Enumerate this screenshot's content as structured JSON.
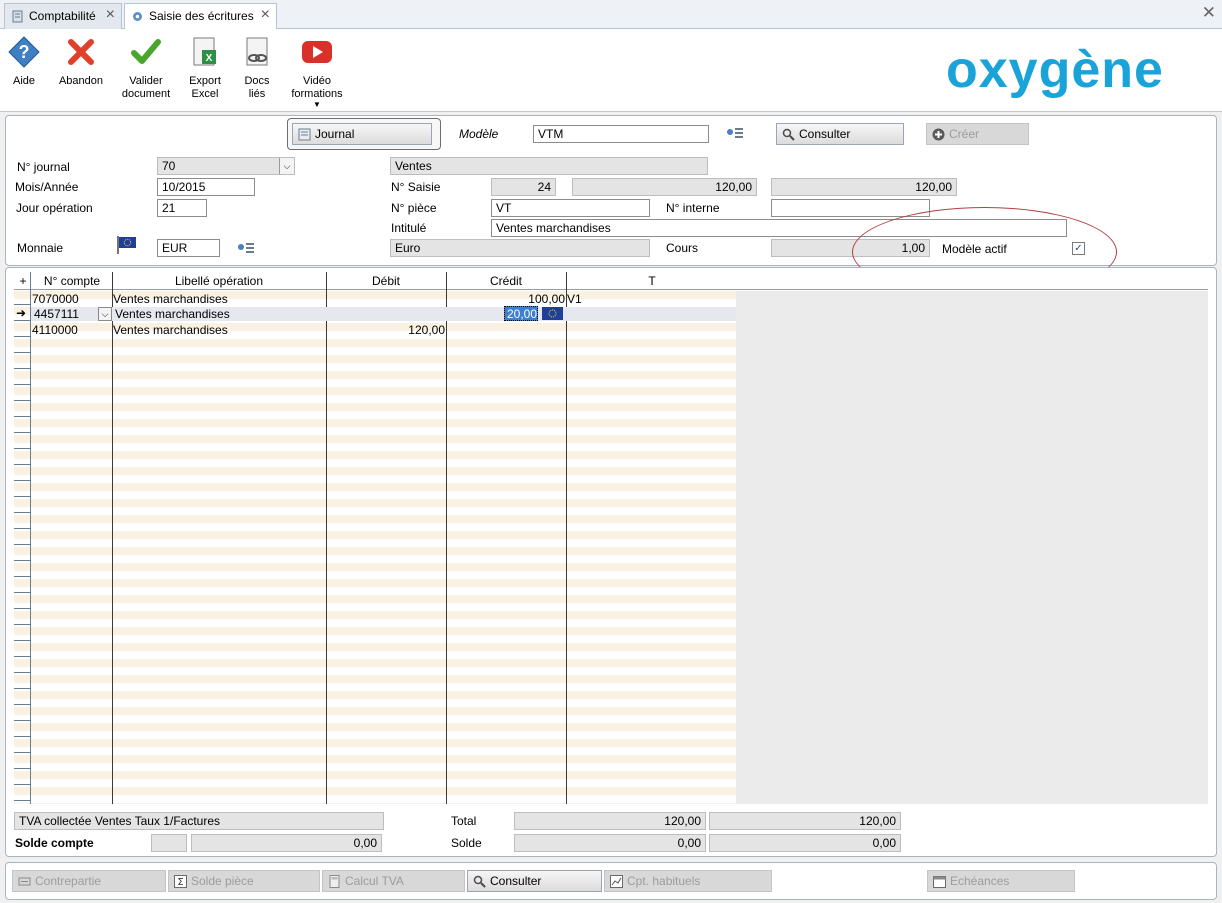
{
  "tabs": [
    {
      "label": "Comptabilité"
    },
    {
      "label": "Saisie des écritures"
    }
  ],
  "toolbar": {
    "aide": "Aide",
    "abandon": "Abandon",
    "valider_1": "Valider",
    "valider_2": "document",
    "export_1": "Export",
    "export_2": "Excel",
    "docs_1": "Docs",
    "docs_2": "liés",
    "video_1": "Vidéo",
    "video_2": "formations",
    "logo": "oxygène"
  },
  "header": {
    "journal_btn": "Journal",
    "modele_label": "Modèle",
    "modele_value": "VTM",
    "consulter_btn": "Consulter",
    "creer_btn": "Créer",
    "n_journal_label": "N° journal",
    "n_journal_value": "70",
    "journal_name": "Ventes",
    "mois_annee_label": "Mois/Année",
    "mois_annee_value": "10/2015",
    "n_saisie_label": "N° Saisie",
    "n_saisie_value": "24",
    "saisie_total_1": "120,00",
    "saisie_total_2": "120,00",
    "jour_label": "Jour opération",
    "jour_value": "21",
    "n_piece_label": "N° pièce",
    "n_piece_value": "VT",
    "n_interne_label": "N° interne",
    "n_interne_value": "",
    "intitule_label": "Intitulé",
    "intitule_value": "Ventes marchandises",
    "monnaie_label": "Monnaie",
    "monnaie_value": "EUR",
    "monnaie_name": "Euro",
    "cours_label": "Cours",
    "cours_value": "1,00",
    "modele_actif_label": "Modèle actif",
    "modele_actif_check": "✓"
  },
  "grid": {
    "add_icon": "+",
    "columns": [
      "N° compte",
      "Libellé opération",
      "Débit",
      "Crédit",
      "T"
    ],
    "rows": [
      {
        "compte": "7070000",
        "libelle": "Ventes marchandises",
        "debit": "",
        "credit": "100,00",
        "t": "V1"
      },
      {
        "compte": "4457111",
        "libelle": "Ventes marchandises",
        "debit": "",
        "credit": "20,00",
        "t": ""
      },
      {
        "compte": "4110000",
        "libelle": "Ventes marchandises",
        "debit": "120,00",
        "credit": "",
        "t": ""
      }
    ]
  },
  "footer": {
    "tva_info": "TVA collectée Ventes Taux 1/Factures",
    "solde_compte_label": "Solde compte",
    "solde_compte_value": "0,00",
    "total_label": "Total",
    "total_debit": "120,00",
    "total_credit": "120,00",
    "solde_label": "Solde",
    "solde_debit": "0,00",
    "solde_credit": "0,00"
  },
  "bottom_buttons": {
    "contrepartie": "Contrepartie",
    "solde_piece": "Solde pièce",
    "calcul_tva": "Calcul TVA",
    "consulter": "Consulter",
    "cpt_habituels": "Cpt. habituels",
    "echeances": "Echéances"
  },
  "colors": {
    "accent": "#1aa3d8",
    "selected_cell": "#3b7fd4",
    "annotation_oval": "#b04040"
  }
}
